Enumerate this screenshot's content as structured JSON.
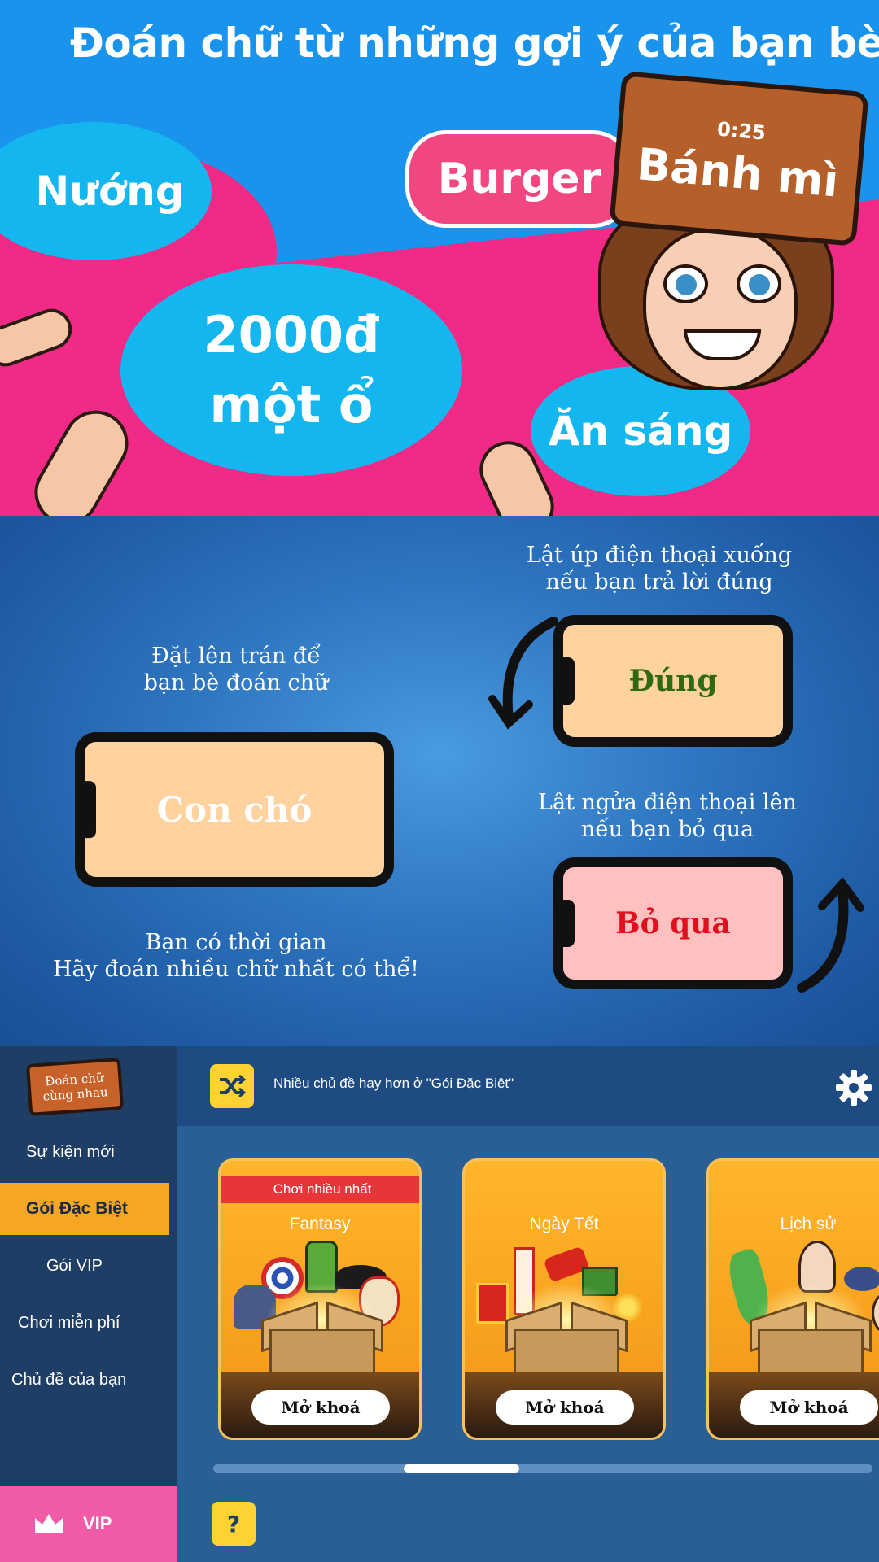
{
  "panel1": {
    "headline": "Đoán chữ từ những gợi ý của bạn bè",
    "bubbles": {
      "nuong": "Nướng",
      "burger": "Burger",
      "price_line1": "2000đ",
      "price_line2": "một ổ",
      "breakfast": "Ăn sáng"
    },
    "card": {
      "timer": "0:25",
      "word": "Bánh mì"
    }
  },
  "panel2": {
    "forehead_line1": "Đặt lên trán để",
    "forehead_line2": "bạn bè đoán chữ",
    "phone_word": "Con chó",
    "correct_line1": "Lật úp điện thoại xuống",
    "correct_line2": "nếu bạn trả lời đúng",
    "correct_label": "Đúng",
    "skip_line1": "Lật ngửa điện thoại lên",
    "skip_line2": "nếu bạn bỏ qua",
    "skip_label": "Bỏ qua",
    "time_line1": "Bạn có thời gian",
    "time_line2": "Hãy đoán nhiều chữ nhất có thể!"
  },
  "app": {
    "logo_line1": "Đoán chữ",
    "logo_line2": "cùng nhau",
    "sidebar": [
      {
        "label": "Sự kiện mới",
        "active": false
      },
      {
        "label": "Gói Đặc Biệt",
        "active": true
      },
      {
        "label": "Gói VIP",
        "active": false
      },
      {
        "label": "Chơi miễn phí",
        "active": false
      },
      {
        "label": "Chủ đề của bạn",
        "active": false
      }
    ],
    "vip_label": "VIP",
    "banner_text": "Nhiều chủ đề hay hơn ở \"Gói Đặc Biệt\"",
    "help_label": "?",
    "cards": [
      {
        "ribbon": "Chơi nhiều nhất",
        "title": "Fantasy",
        "unlock": "Mở khoá"
      },
      {
        "title": "Ngày Tết",
        "unlock": "Mở khoá"
      },
      {
        "title": "Lịch sử",
        "unlock": "Mở khoá"
      }
    ],
    "colors": {
      "accent_orange": "#f5a623",
      "vip_pink": "#f05aa6",
      "button_yellow": "#ffd234",
      "correct_green": "#2f6a12",
      "skip_red": "#e0101c"
    }
  }
}
